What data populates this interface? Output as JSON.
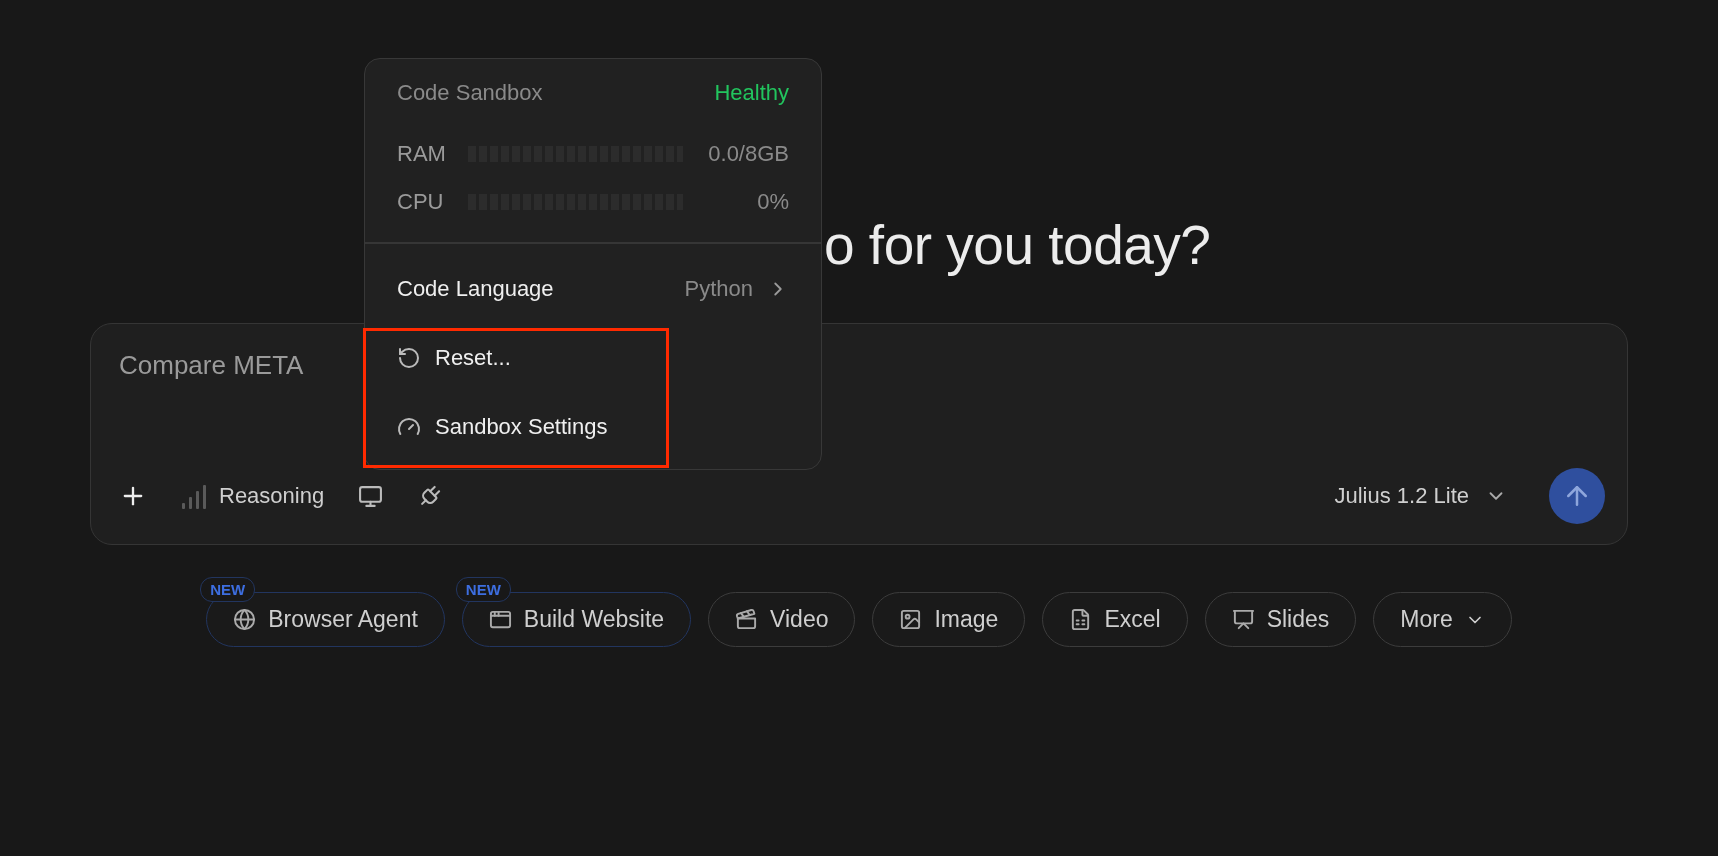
{
  "heading": "o for you today?",
  "composer": {
    "placeholder": "Compare META",
    "toolbar": {
      "reasoning_label": "Reasoning",
      "model": "Julius 1.2 Lite"
    }
  },
  "sandbox_menu": {
    "title": "Code Sandbox",
    "status": "Healthy",
    "meters": [
      {
        "label": "RAM",
        "level": 0,
        "reading": "0.0/8GB"
      },
      {
        "label": "CPU",
        "level": 0,
        "reading": "0%"
      }
    ],
    "items": [
      {
        "kind": "submenu",
        "label": "Code Language",
        "value": "Python"
      },
      {
        "kind": "reset",
        "label": "Reset..."
      },
      {
        "kind": "settings",
        "label": "Sandbox Settings"
      }
    ]
  },
  "chips": [
    {
      "kind": "action",
      "label": "Browser Agent",
      "badge": "NEW"
    },
    {
      "kind": "action",
      "label": "Build Website",
      "badge": "NEW"
    },
    {
      "kind": "action",
      "label": "Video"
    },
    {
      "kind": "action",
      "label": "Image"
    },
    {
      "kind": "action",
      "label": "Excel"
    },
    {
      "kind": "action",
      "label": "Slides"
    },
    {
      "kind": "more",
      "label": "More"
    }
  ]
}
